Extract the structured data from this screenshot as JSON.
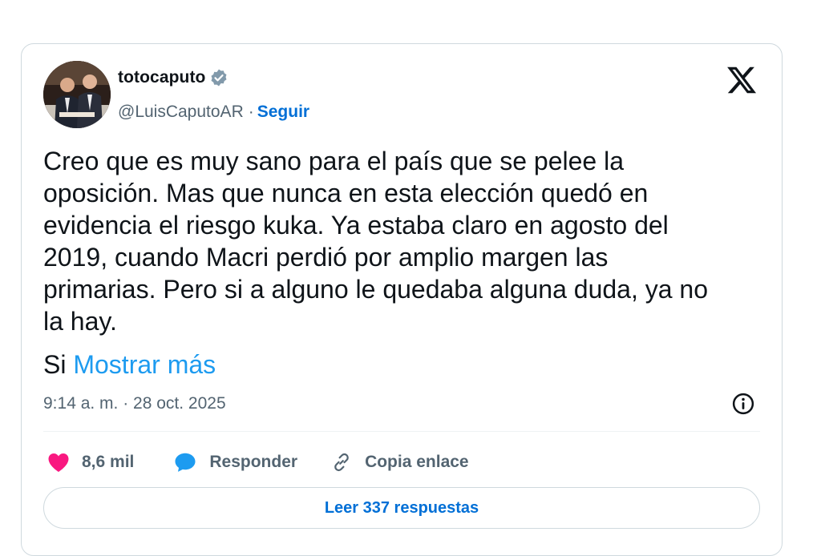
{
  "author": {
    "display_name": "totocaputo",
    "handle": "@LuisCaputoAR",
    "separator": "·",
    "follow_label": "Seguir"
  },
  "tweet": {
    "text": "Creo que es muy sano para el país que se pelee la\noposición. Mas que nunca en esta elección quedó en\nevidencia el riesgo kuka. Ya estaba claro en agosto del\n2019, cuando Macri perdió por amplio margen las\nprimarias. Pero si a alguno le quedaba alguna duda, ya no\nla hay.",
    "truncated_fragment": "Si",
    "show_more_label": "Mostrar más",
    "timestamp": "9:14 a. m. · 28 oct. 2025"
  },
  "actions": {
    "likes_count": "8,6 mil",
    "reply_label": "Responder",
    "copy_link_label": "Copia enlace",
    "read_replies_label": "Leer 337 respuestas"
  },
  "icons": {
    "verified": "verified-badge-icon",
    "brand": "x-logo-icon",
    "info": "info-icon",
    "like": "heart-icon",
    "reply": "speech-bubble-icon",
    "link": "link-icon"
  },
  "colors": {
    "link_blue": "#006fd6",
    "show_more_blue": "#1d9bf0",
    "heart_pink": "#f91880",
    "reply_blue": "#1d9bf0",
    "secondary_text": "#536471",
    "border": "#cfd9de"
  }
}
